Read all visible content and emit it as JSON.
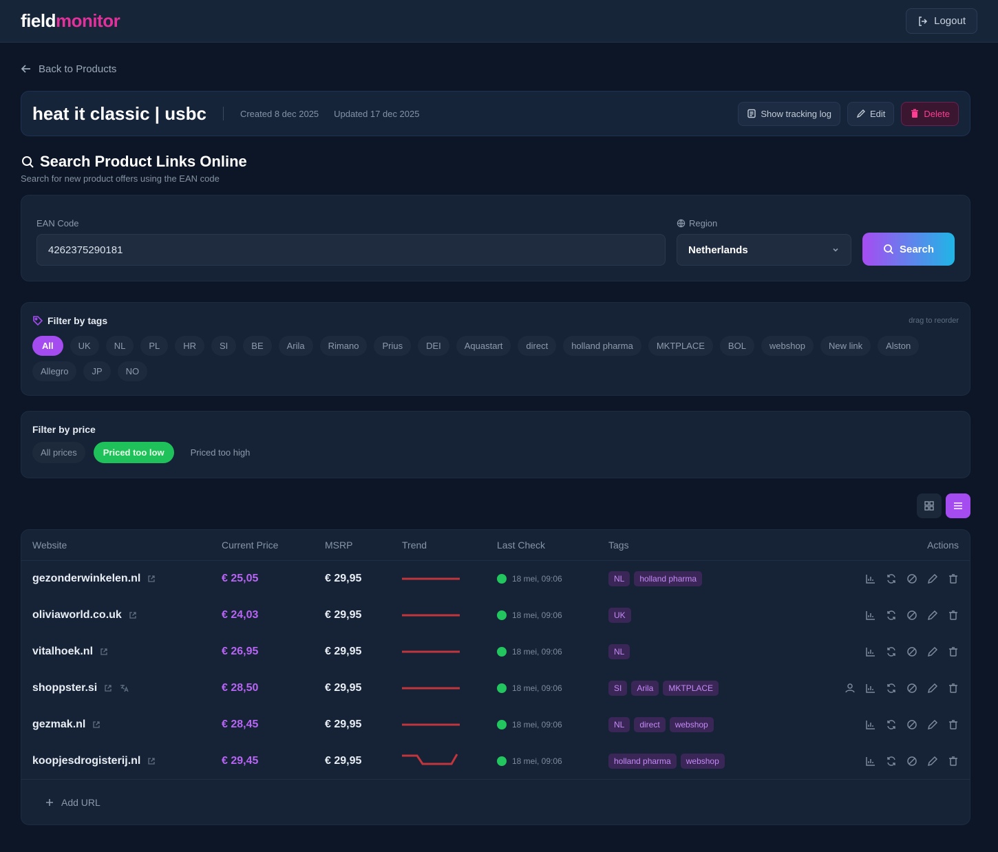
{
  "app": {
    "logo_a": "field",
    "logo_b": "monitor",
    "logout_label": "Logout"
  },
  "nav": {
    "back_label": "Back to Products"
  },
  "product": {
    "title": "heat it classic | usbc",
    "created": "Created 8 dec 2025",
    "updated": "Updated 17 dec 2025",
    "actions": {
      "tracking_log": "Show tracking log",
      "edit": "Edit",
      "delete": "Delete"
    }
  },
  "search": {
    "title": "Search Product Links Online",
    "subtitle": "Search for new product offers using the EAN code",
    "ean_label": "EAN Code",
    "ean_value": "4262375290181",
    "region_label": "Region",
    "region_value": "Netherlands",
    "button_label": "Search"
  },
  "tag_filter": {
    "title": "Filter by tags",
    "hint": "drag to reorder",
    "tags": [
      "All",
      "UK",
      "NL",
      "PL",
      "HR",
      "SI",
      "BE",
      "Arila",
      "Rimano",
      "Prius",
      "DEI",
      "Aquastart",
      "direct",
      "holland pharma",
      "MKTPLACE",
      "BOL",
      "webshop",
      "New link",
      "Alston",
      "Allegro",
      "JP",
      "NO"
    ],
    "active": "All"
  },
  "price_filter": {
    "title": "Filter by price",
    "options": [
      "All prices",
      "Priced too low",
      "Priced too high"
    ],
    "active": "Priced too low"
  },
  "table": {
    "columns": [
      "Website",
      "Current Price",
      "MSRP",
      "Trend",
      "Last Check",
      "Tags",
      "Actions"
    ],
    "rows": [
      {
        "site": "gezonderwinkelen.nl",
        "price": "€ 25,05",
        "msrp": "€ 29,95",
        "last_check": "18 mei, 09:06",
        "tags": [
          "NL",
          "holland pharma"
        ],
        "extra": false
      },
      {
        "site": "oliviaworld.co.uk",
        "price": "€ 24,03",
        "msrp": "€ 29,95",
        "last_check": "18 mei, 09:06",
        "tags": [
          "UK"
        ],
        "extra": false
      },
      {
        "site": "vitalhoek.nl",
        "price": "€ 26,95",
        "msrp": "€ 29,95",
        "last_check": "18 mei, 09:06",
        "tags": [
          "NL"
        ],
        "extra": false
      },
      {
        "site": "shoppster.si",
        "price": "€ 28,50",
        "msrp": "€ 29,95",
        "last_check": "18 mei, 09:06",
        "tags": [
          "SI",
          "Arila",
          "MKTPLACE"
        ],
        "extra": true
      },
      {
        "site": "gezmak.nl",
        "price": "€ 28,45",
        "msrp": "€ 29,95",
        "last_check": "18 mei, 09:06",
        "tags": [
          "NL",
          "direct",
          "webshop"
        ],
        "extra": false
      },
      {
        "site": "koopjesdrogisterij.nl",
        "price": "€ 29,45",
        "msrp": "€ 29,95",
        "last_check": "18 mei, 09:06",
        "tags": [
          "holland pharma",
          "webshop"
        ],
        "extra": false
      }
    ],
    "add_url_label": "Add URL"
  },
  "colors": {
    "accent_purple": "#a44cf0",
    "accent_pink": "#e0329a",
    "success_green": "#22c55e",
    "trend_red": "#c0363c"
  }
}
